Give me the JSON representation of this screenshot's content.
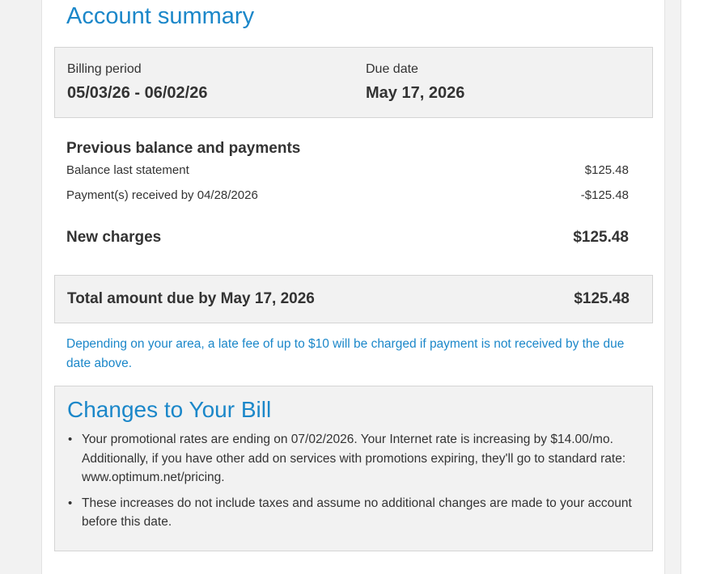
{
  "account_summary": {
    "title": "Account summary",
    "billing_period": {
      "label": "Billing period",
      "value": "05/03/26 - 06/02/26"
    },
    "due_date": {
      "label": "Due date",
      "value": "May 17, 2026"
    }
  },
  "previous_balance": {
    "heading": "Previous balance and payments",
    "rows": [
      {
        "label": "Balance last statement",
        "amount": "$125.48"
      },
      {
        "label": "Payment(s) received by 04/28/2026",
        "amount": "-$125.48"
      }
    ]
  },
  "new_charges": {
    "label": "New charges",
    "amount": "$125.48"
  },
  "total_due": {
    "label": "Total amount due by May 17, 2026",
    "amount": "$125.48"
  },
  "late_fee_notice": "Depending on your area, a late fee of up to $10 will be charged if payment is not received by the due date above.",
  "changes": {
    "title": "Changes to Your Bill",
    "items": [
      "Your promotional rates are ending on 07/02/2026. Your Internet rate is increasing by $14.00/mo. Additionally, if you have other add on services with promotions expiring, they'll go to standard rate: www.optimum.net/pricing.",
      "These increases do not include taxes and assume no additional changes are made to your account before this date."
    ],
    "bullet": "•"
  },
  "colors": {
    "accent_blue": "#1b87c9",
    "text": "#333333",
    "panel_bg": "#f2f2f2",
    "panel_border": "#d4d4d4"
  }
}
